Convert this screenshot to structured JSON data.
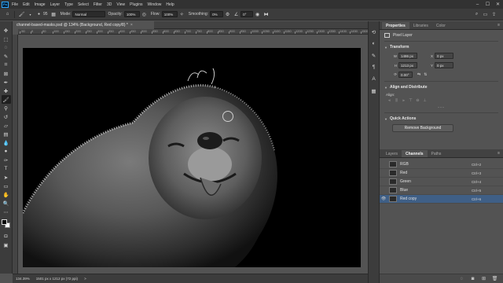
{
  "app": {
    "logo_text": "Ps"
  },
  "menu": [
    "File",
    "Edit",
    "Image",
    "Layer",
    "Type",
    "Select",
    "Filter",
    "3D",
    "View",
    "Plugins",
    "Window",
    "Help"
  ],
  "window_controls": {
    "minimize": "–",
    "maximize": "☐",
    "close": "✕"
  },
  "options_bar": {
    "brush_size": "95",
    "mode_label": "Mode:",
    "mode_value": "Normal",
    "opacity_label": "Opacity:",
    "opacity_value": "100%",
    "flow_label": "Flow:",
    "flow_value": "100%",
    "smoothing_label": "Smoothing:",
    "smoothing_value": "0%",
    "angle_value": "0°"
  },
  "document": {
    "tab_title": "channel-based-masks.psd @ 134% (Background, Red copy/8) *",
    "close": "×"
  },
  "ruler": {
    "top_labels": [
      "-50",
      "0",
      "50",
      "100",
      "150",
      "200",
      "250",
      "300",
      "350",
      "400",
      "450",
      "500",
      "550",
      "600",
      "650",
      "700",
      "750",
      "800",
      "850",
      "900",
      "950",
      "1000",
      "1050",
      "1100",
      "1150",
      "1200",
      "1250",
      "1300",
      "1350",
      "1400",
      "1450",
      "1500"
    ]
  },
  "status": {
    "zoom": "134.39%",
    "dimensions": "1501 px x 1212 px (72 ppi)",
    "arrow": ">"
  },
  "properties": {
    "tabs": [
      "Properties",
      "Libraries",
      "Color"
    ],
    "layer_type": "Pixel Layer",
    "transform_title": "Transform",
    "w_label": "W",
    "w_value": "1486 px",
    "x_label": "X",
    "x_value": "0 px",
    "h_label": "H",
    "h_value": "1213 px",
    "y_label": "Y",
    "y_value": "0 px",
    "angle_value": "0.00°",
    "align_title": "Align and Distribute",
    "align_label": "Align:",
    "quick_actions_title": "Quick Actions",
    "remove_bg_button": "Remove Background"
  },
  "layers_panel": {
    "tabs": [
      "Layers",
      "Channels",
      "Paths"
    ],
    "channels": [
      {
        "name": "RGB",
        "shortcut": "Ctrl+2",
        "selected": false
      },
      {
        "name": "Red",
        "shortcut": "Ctrl+3",
        "selected": false
      },
      {
        "name": "Green",
        "shortcut": "Ctrl+4",
        "selected": false
      },
      {
        "name": "Blue",
        "shortcut": "Ctrl+5",
        "selected": false
      },
      {
        "name": "Red copy",
        "shortcut": "Ctrl+6",
        "selected": true
      }
    ]
  },
  "colors": {
    "selection": "#3f5f86",
    "accent_logo": "#31a8ff",
    "canvas": "#000000"
  }
}
